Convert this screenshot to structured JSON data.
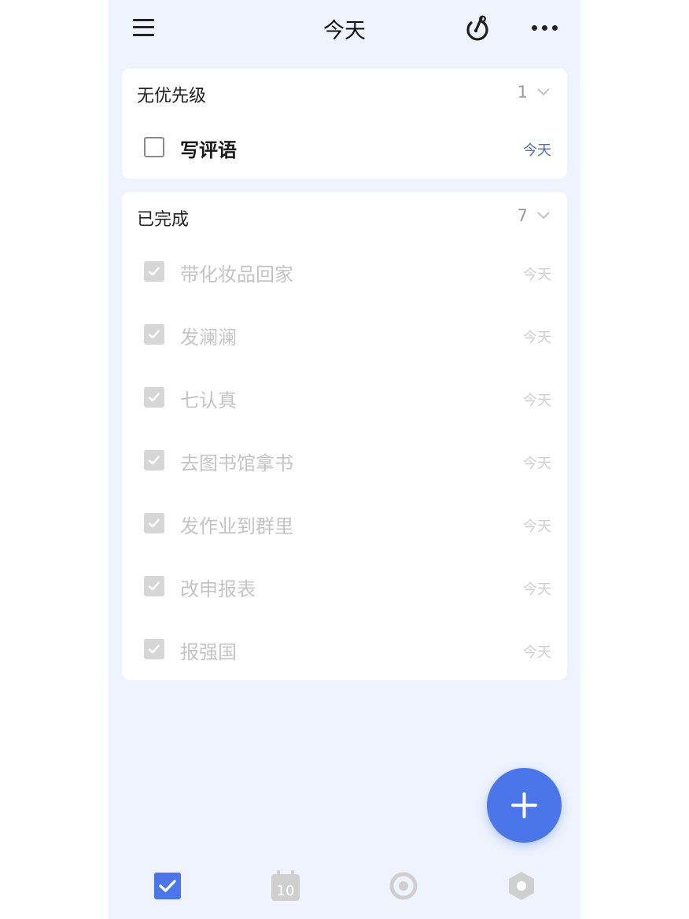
{
  "header": {
    "title": "今天",
    "menu_icon": "hamburger-menu-icon",
    "focus_icon": "focus-timer-icon",
    "more_icon": "more-dots-icon"
  },
  "sections": [
    {
      "title": "无优先级",
      "count": "1",
      "tasks": [
        {
          "text": "写评语",
          "date": "今天",
          "done": false
        }
      ]
    },
    {
      "title": "已完成",
      "count": "7",
      "tasks": [
        {
          "text": "带化妆品回家",
          "date": "今天",
          "done": true
        },
        {
          "text": "发澜澜",
          "date": "今天",
          "done": true
        },
        {
          "text": "七认真",
          "date": "今天",
          "done": true
        },
        {
          "text": "去图书馆拿书",
          "date": "今天",
          "done": true
        },
        {
          "text": "发作业到群里",
          "date": "今天",
          "done": true
        },
        {
          "text": "改申报表",
          "date": "今天",
          "done": true
        },
        {
          "text": "报强国",
          "date": "今天",
          "done": true
        }
      ]
    }
  ],
  "tabbar": {
    "calendar_day": "10",
    "tabs": [
      {
        "name": "tasks",
        "icon": "task-checkbox-icon",
        "active": true
      },
      {
        "name": "calendar",
        "icon": "calendar-icon",
        "active": false
      },
      {
        "name": "focus",
        "icon": "focus-circle-icon",
        "active": false
      },
      {
        "name": "habit",
        "icon": "hexagon-icon",
        "active": false
      }
    ]
  },
  "colors": {
    "accent": "#4a76ea",
    "background": "#eef3fd",
    "date_active": "#4a6fc1",
    "done_text": "#c4c4c4"
  }
}
